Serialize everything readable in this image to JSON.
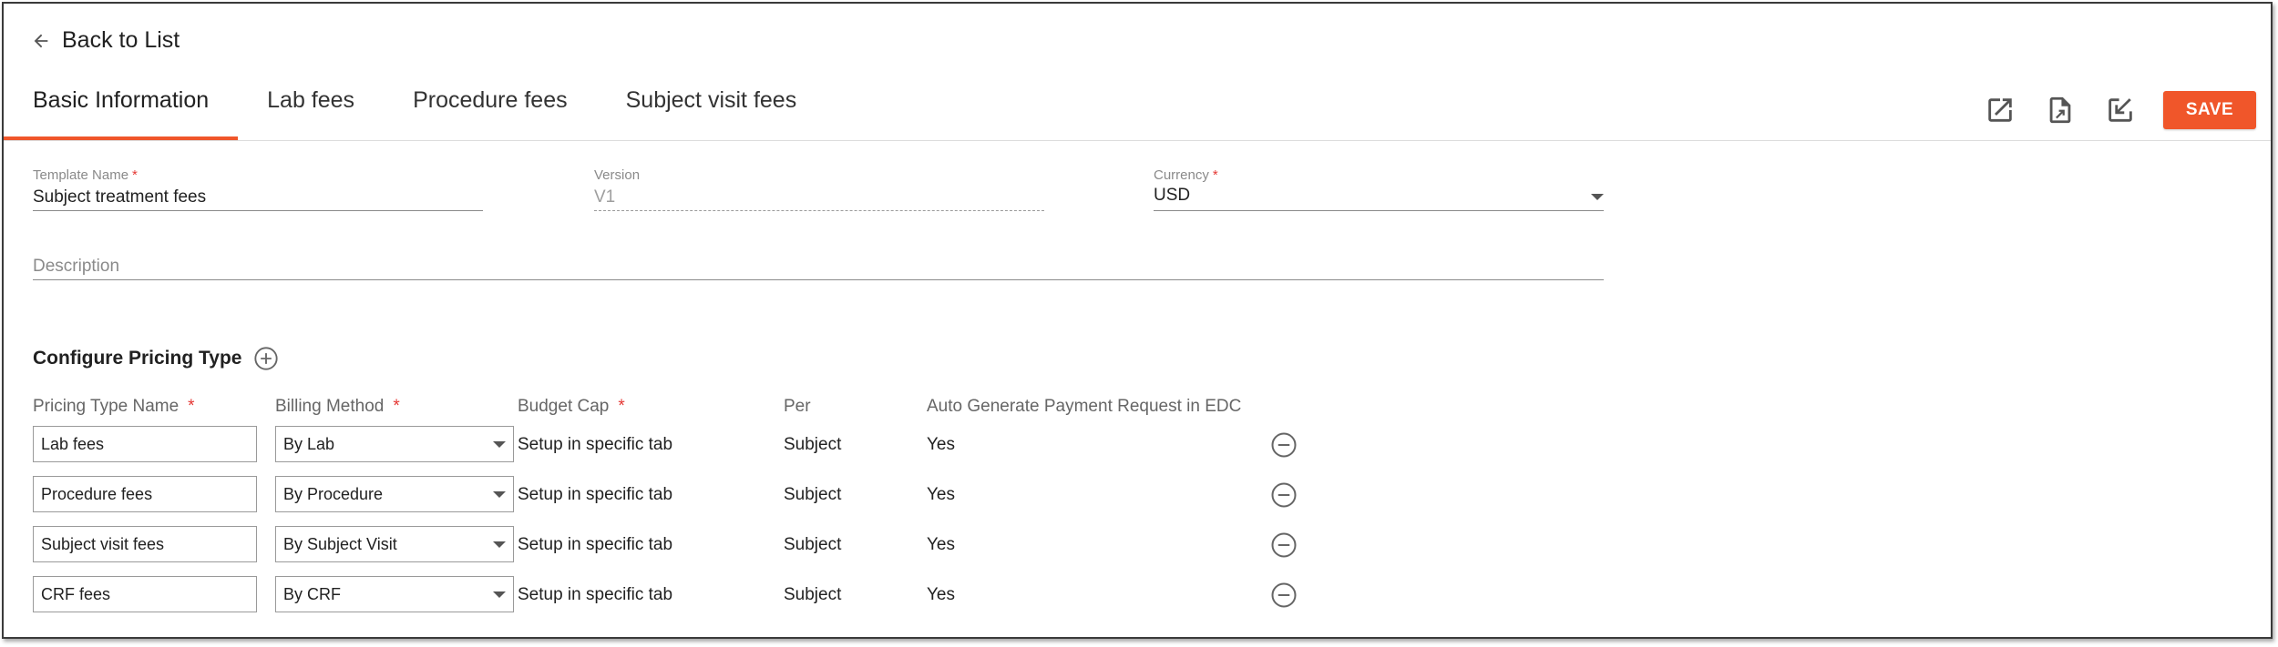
{
  "back": {
    "label": "Back to List"
  },
  "tabs": [
    {
      "label": "Basic Information",
      "active": true
    },
    {
      "label": "Lab fees",
      "active": false
    },
    {
      "label": "Procedure fees",
      "active": false
    },
    {
      "label": "Subject visit fees",
      "active": false
    }
  ],
  "toolbar": {
    "icons": [
      "open-external-icon",
      "export-document-icon",
      "import-icon"
    ],
    "save_label": "SAVE"
  },
  "form": {
    "template_name": {
      "label": "Template Name",
      "required_mark": "*",
      "value": "Subject treatment fees"
    },
    "version": {
      "label": "Version",
      "value": "V1"
    },
    "currency": {
      "label": "Currency",
      "required_mark": "*",
      "value": "USD"
    },
    "description": {
      "label": "Description",
      "value": ""
    }
  },
  "pricing": {
    "title": "Configure Pricing Type",
    "columns": {
      "name": "Pricing Type Name",
      "billing": "Billing Method",
      "cap": "Budget Cap",
      "per": "Per",
      "auto": "Auto Generate Payment Request in EDC",
      "required_mark": "*"
    },
    "rows": [
      {
        "name": "Lab fees",
        "billing": "By Lab",
        "cap": "Setup in specific tab",
        "per": "Subject",
        "auto": "Yes"
      },
      {
        "name": "Procedure fees",
        "billing": "By Procedure",
        "cap": "Setup in specific tab",
        "per": "Subject",
        "auto": "Yes"
      },
      {
        "name": "Subject visit fees",
        "billing": "By Subject Visit",
        "cap": "Setup in specific tab",
        "per": "Subject",
        "auto": "Yes"
      },
      {
        "name": "CRF fees",
        "billing": "By CRF",
        "cap": "Setup in specific tab",
        "per": "Subject",
        "auto": "Yes"
      }
    ]
  },
  "colors": {
    "accent": "#f0562a",
    "required": "#e53935"
  }
}
